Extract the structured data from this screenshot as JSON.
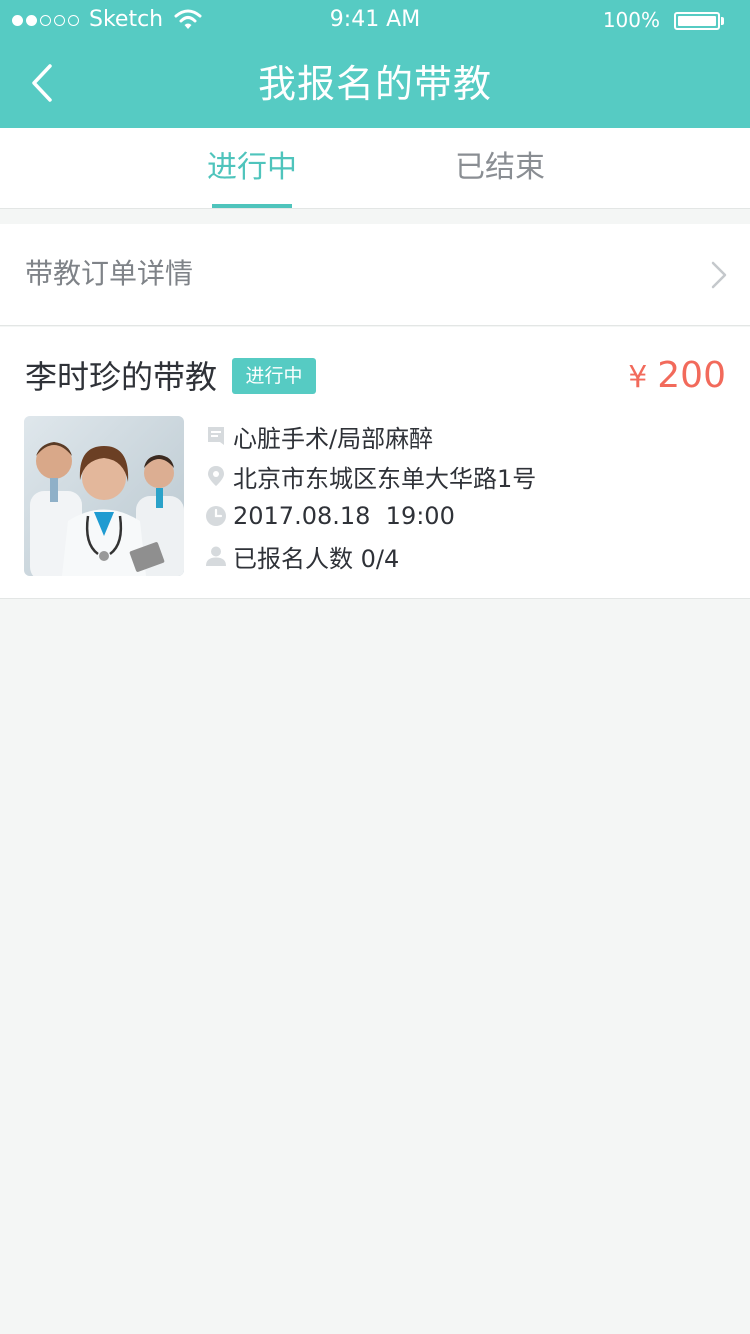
{
  "status_bar": {
    "carrier": "Sketch",
    "time": "9:41 AM",
    "battery": "100%"
  },
  "nav": {
    "title": "我报名的带教"
  },
  "tabs": [
    {
      "label": "进行中",
      "active": true
    },
    {
      "label": "已结束",
      "active": false
    }
  ],
  "detail_row": {
    "label": "带教订单详情"
  },
  "card": {
    "title": "李时珍的带教",
    "badge": "进行中",
    "currency": "¥",
    "price": "200",
    "course": "心脏手术/局部麻醉",
    "address": "北京市东城区东单大华路1号",
    "datetime": "2017.08.18  19:00",
    "enrolled": "已报名人数 0/4"
  },
  "colors": {
    "accent": "#56cbc3",
    "price": "#f26a5b",
    "background": "#f4f6f5"
  },
  "icons": [
    "back-icon",
    "chevron-right-icon",
    "course-icon",
    "location-icon",
    "clock-icon",
    "person-icon",
    "wifi-icon",
    "battery-icon"
  ]
}
